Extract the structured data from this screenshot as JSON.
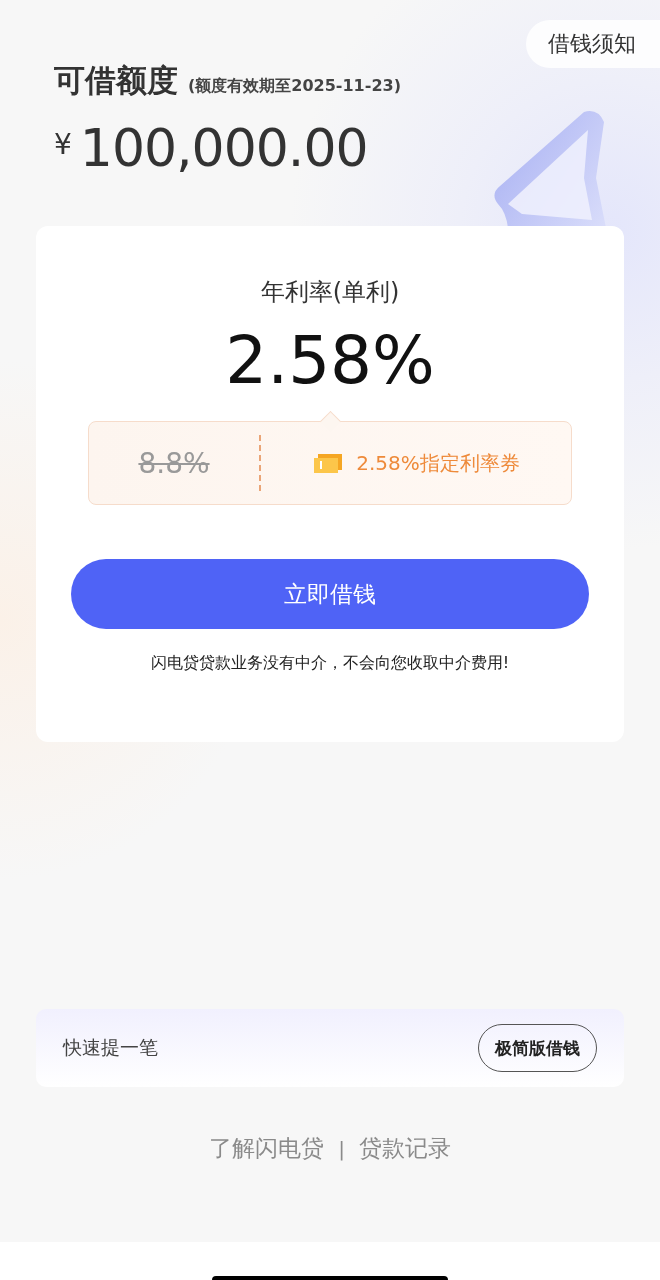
{
  "notice_button": "借钱须知",
  "credit": {
    "title": "可借额度",
    "validity": "(额度有效期至2025-11-23)",
    "currency": "¥",
    "amount": "100,000.00"
  },
  "rate": {
    "label": "年利率(单利)",
    "value": "2.58%"
  },
  "coupon": {
    "original_rate": "8.8%",
    "text": "2.58%指定利率券"
  },
  "borrow_button": "立即借钱",
  "disclaimer": "闪电贷贷款业务没有中介，不会向您收取中介费用!",
  "quick": {
    "label": "快速提一笔",
    "button": "极简版借钱"
  },
  "footer_links": [
    "了解闪电贷",
    "贷款记录"
  ],
  "footer_separator": "|"
}
